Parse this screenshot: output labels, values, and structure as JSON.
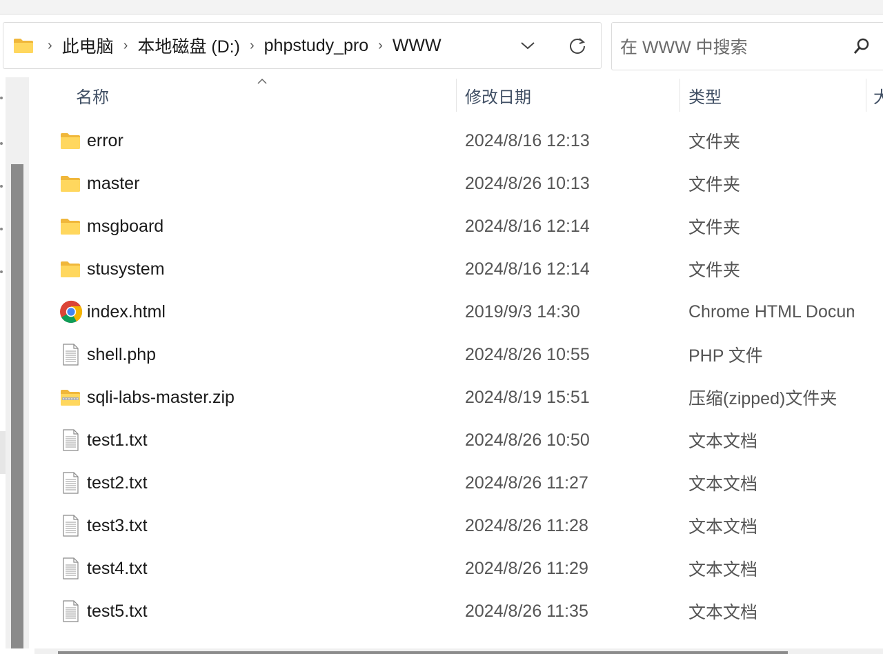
{
  "address": {
    "crumbs": [
      "此电脑",
      "本地磁盘 (D:)",
      "phpstudy_pro",
      "WWW"
    ]
  },
  "search": {
    "placeholder": "在 WWW 中搜索"
  },
  "columns": {
    "name": "名称",
    "date": "修改日期",
    "type": "类型",
    "size": "大"
  },
  "files": [
    {
      "name": "error",
      "date": "2024/8/16 12:13",
      "type": "文件夹",
      "icon": "folder"
    },
    {
      "name": "master",
      "date": "2024/8/26 10:13",
      "type": "文件夹",
      "icon": "folder"
    },
    {
      "name": "msgboard",
      "date": "2024/8/16 12:14",
      "type": "文件夹",
      "icon": "folder"
    },
    {
      "name": "stusystem",
      "date": "2024/8/16 12:14",
      "type": "文件夹",
      "icon": "folder"
    },
    {
      "name": "index.html",
      "date": "2019/9/3 14:30",
      "type": "Chrome HTML Document",
      "icon": "chrome"
    },
    {
      "name": "shell.php",
      "date": "2024/8/26 10:55",
      "type": "PHP 文件",
      "icon": "file"
    },
    {
      "name": "sqli-labs-master.zip",
      "date": "2024/8/19 15:51",
      "type": "压缩(zipped)文件夹",
      "icon": "zip"
    },
    {
      "name": "test1.txt",
      "date": "2024/8/26 10:50",
      "type": "文本文档",
      "icon": "file"
    },
    {
      "name": "test2.txt",
      "date": "2024/8/26 11:27",
      "type": "文本文档",
      "icon": "file"
    },
    {
      "name": "test3.txt",
      "date": "2024/8/26 11:28",
      "type": "文本文档",
      "icon": "file"
    },
    {
      "name": "test4.txt",
      "date": "2024/8/26 11:29",
      "type": "文本文档",
      "icon": "file"
    },
    {
      "name": "test5.txt",
      "date": "2024/8/26 11:35",
      "type": "文本文档",
      "icon": "file"
    }
  ],
  "colors": {
    "folder": "#ffd75e",
    "folder_dark": "#f0b73b",
    "header_text": "#3f4e63"
  }
}
